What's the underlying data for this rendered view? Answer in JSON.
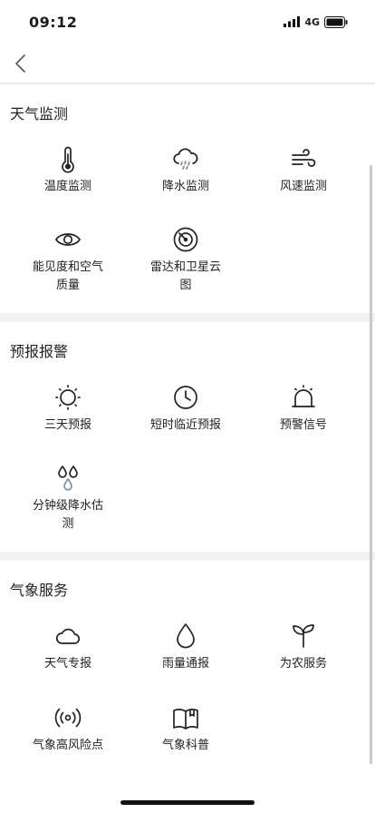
{
  "status": {
    "time": "09:12",
    "network": "4G"
  },
  "sections": [
    {
      "title": "天气监测",
      "items": [
        {
          "label": "温度监测",
          "icon": "thermometer-icon"
        },
        {
          "label": "降水监测",
          "icon": "rain-cloud-icon"
        },
        {
          "label": "风速监测",
          "icon": "wind-icon"
        },
        {
          "label": "能见度和空气质量",
          "icon": "eye-icon"
        },
        {
          "label": "雷达和卫星云图",
          "icon": "radar-icon"
        }
      ]
    },
    {
      "title": "预报报警",
      "items": [
        {
          "label": "三天预报",
          "icon": "sun-icon"
        },
        {
          "label": "短时临近预报",
          "icon": "clock-icon"
        },
        {
          "label": "预警信号",
          "icon": "alarm-light-icon"
        },
        {
          "label": "分钟级降水估测",
          "icon": "raindrops-icon"
        }
      ]
    },
    {
      "title": "气象服务",
      "items": [
        {
          "label": "天气专报",
          "icon": "cloud-icon"
        },
        {
          "label": "雨量通报",
          "icon": "water-drop-icon"
        },
        {
          "label": "为农服务",
          "icon": "sprout-icon"
        },
        {
          "label": "气象高风险点",
          "icon": "broadcast-icon"
        },
        {
          "label": "气象科普",
          "icon": "open-book-icon"
        }
      ]
    }
  ]
}
